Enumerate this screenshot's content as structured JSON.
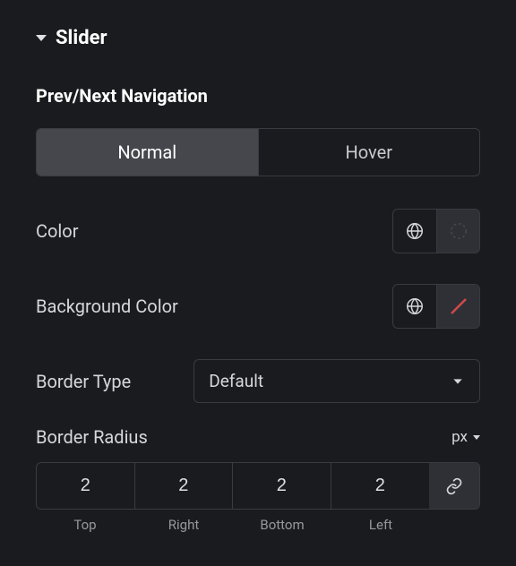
{
  "section": {
    "title": "Slider"
  },
  "subsection": {
    "title": "Prev/Next Navigation"
  },
  "tabs": {
    "normal": "Normal",
    "hover": "Hover"
  },
  "color": {
    "label": "Color"
  },
  "backgroundColor": {
    "label": "Background Color"
  },
  "borderType": {
    "label": "Border Type",
    "value": "Default"
  },
  "borderRadius": {
    "label": "Border Radius",
    "unit": "px",
    "top": "2",
    "right": "2",
    "bottom": "2",
    "left": "2",
    "labelTop": "Top",
    "labelRight": "Right",
    "labelBottom": "Bottom",
    "labelLeft": "Left"
  }
}
